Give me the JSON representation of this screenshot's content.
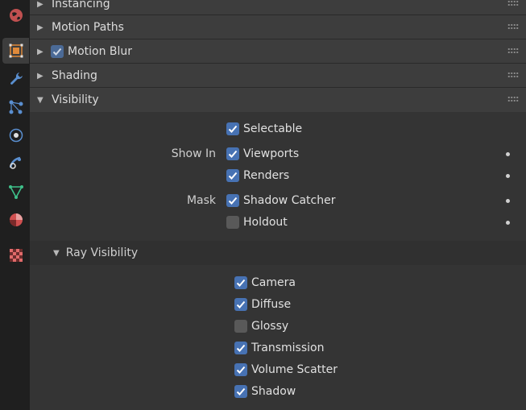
{
  "sidebar": {
    "tabs": [
      {
        "icon": "world-icon",
        "color": "#c05050"
      },
      {
        "icon": "object-icon",
        "color": "#e08a3a",
        "active": true
      },
      {
        "icon": "wrench-icon",
        "color": "#5a8fd0"
      },
      {
        "icon": "particles-icon",
        "color": "#5a8fd0"
      },
      {
        "icon": "physics-icon",
        "color": "#5a8fd0"
      },
      {
        "icon": "constraints-icon",
        "color": "#5a8fd0"
      },
      {
        "icon": "data-icon",
        "color": "#3fc08a"
      },
      {
        "icon": "material-icon",
        "color": "#d05050"
      },
      {
        "icon": "texture-icon",
        "color": "#d05050"
      }
    ]
  },
  "panels": [
    {
      "label": "Instancing",
      "collapsed": true
    },
    {
      "label": "Motion Paths",
      "collapsed": true
    },
    {
      "label": "Motion Blur",
      "collapsed": true,
      "checkbox": true
    },
    {
      "label": "Shading",
      "collapsed": true
    },
    {
      "label": "Visibility",
      "collapsed": false
    }
  ],
  "visibility": {
    "selectable": {
      "label": "Selectable",
      "checked": true
    },
    "show_in_label": "Show In",
    "viewports": {
      "label": "Viewports",
      "checked": true
    },
    "renders": {
      "label": "Renders",
      "checked": true
    },
    "mask_label": "Mask",
    "shadow_catcher": {
      "label": "Shadow Catcher",
      "checked": true
    },
    "holdout": {
      "label": "Holdout",
      "checked": false
    }
  },
  "ray_visibility": {
    "label": "Ray Visibility",
    "items": [
      {
        "label": "Camera",
        "checked": true
      },
      {
        "label": "Diffuse",
        "checked": true
      },
      {
        "label": "Glossy",
        "checked": false
      },
      {
        "label": "Transmission",
        "checked": true
      },
      {
        "label": "Volume Scatter",
        "checked": true
      },
      {
        "label": "Shadow",
        "checked": true
      }
    ]
  },
  "colors": {
    "accent": "#4772b3",
    "panel_bg": "#3d3d3d",
    "bg": "#303030"
  }
}
